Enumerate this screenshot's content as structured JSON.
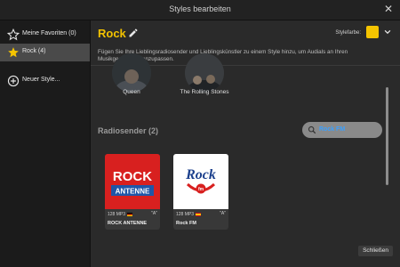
{
  "window": {
    "title": "Styles bearbeiten",
    "close_glyph": "✕"
  },
  "sidebar": {
    "items": [
      {
        "label": "Meine Favoriten (0)",
        "icon": "star-outline-icon"
      },
      {
        "label": "Rock (4)",
        "icon": "star-filled-icon",
        "active": true
      },
      {
        "label": "Neuer Style...",
        "icon": "plus-circle-icon"
      }
    ]
  },
  "header": {
    "title": "Rock",
    "style_color_label": "Stylefarbe:",
    "style_color": "#F5C400",
    "description": "Fügen Sie Ihre Lieblingsradiosender und Lieblingskünstler zu einem Style hinzu, um Audials an Ihren Musikgeschmack anzupassen."
  },
  "artists": [
    {
      "name": "Queen"
    },
    {
      "name": "The Rolling Stones"
    }
  ],
  "stations_section": {
    "title": "Radiosender (2)"
  },
  "search": {
    "value": "Rock FM"
  },
  "stations": [
    {
      "name": "ROCK ANTENNE",
      "meta": "128  MP3",
      "flag": "de",
      "autodetect": "\"A\"",
      "logo_text_top": "ROCK",
      "logo_text_bottom": "ANTENNE"
    },
    {
      "name": "Rock FM",
      "meta": "128  MP3",
      "flag": "es",
      "autodetect": "\"A\"",
      "logo_text_top": "Rock",
      "logo_text_bottom": "fm"
    }
  ],
  "footer": {
    "close_label": "Schließen"
  },
  "colors": {
    "accent": "#F2C200",
    "link": "#3AA0FF"
  }
}
